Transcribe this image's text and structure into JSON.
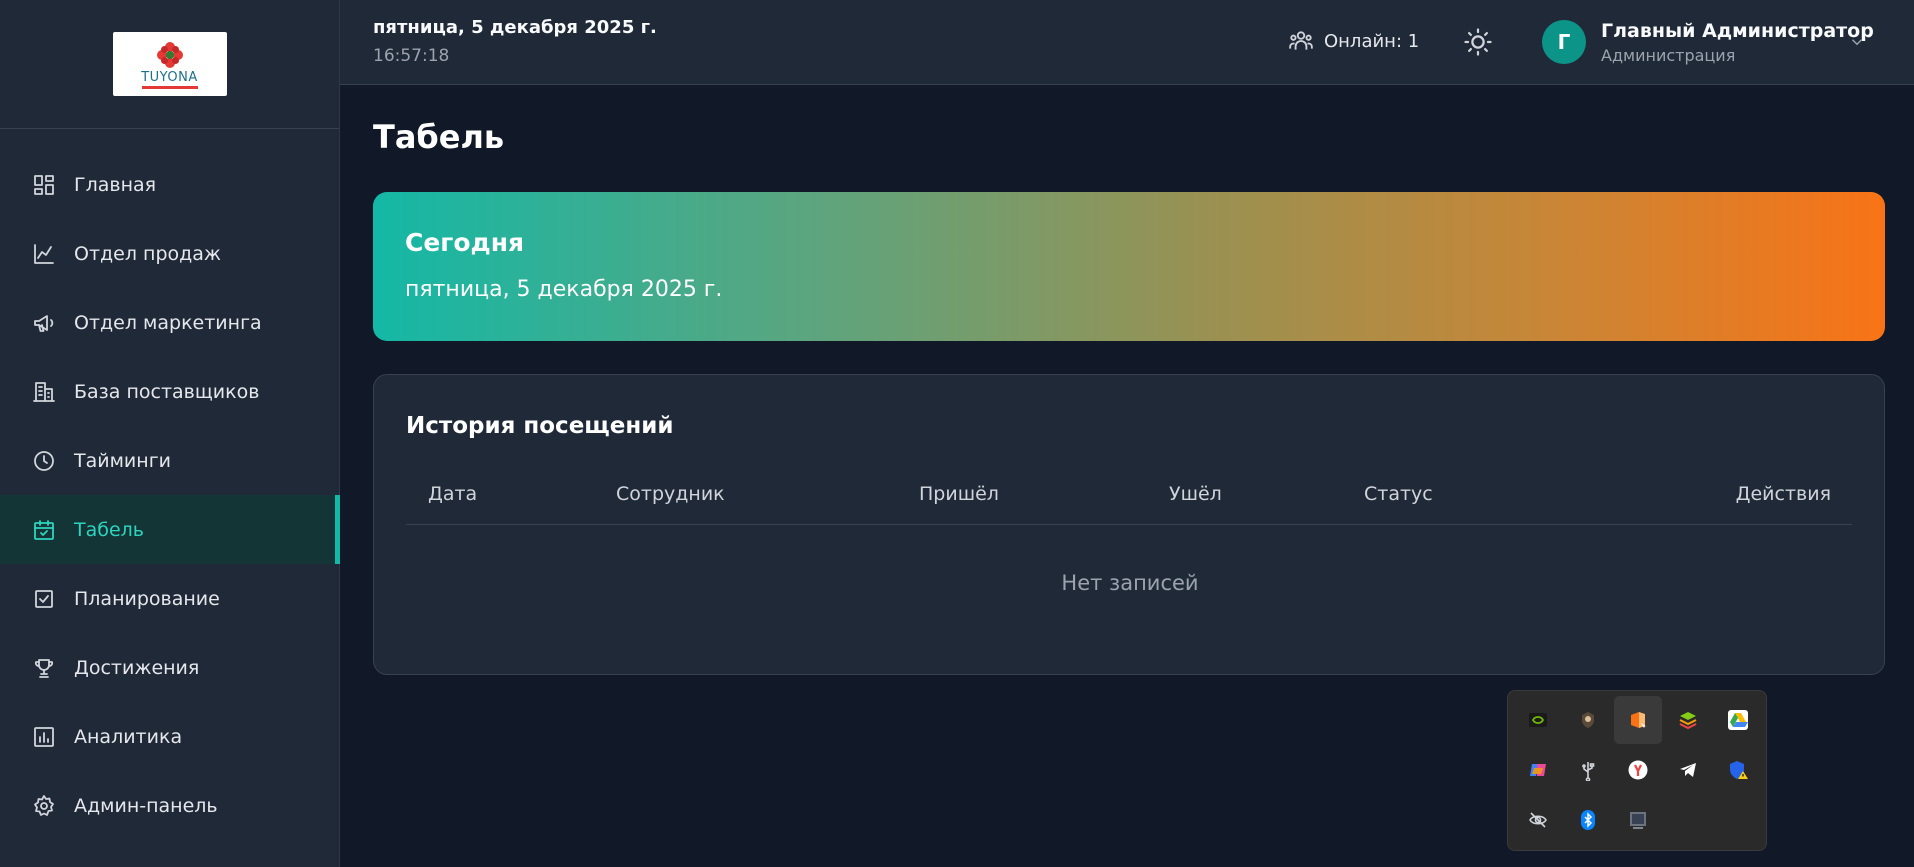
{
  "logo": {
    "brand": "TUYONA"
  },
  "sidebar": {
    "items": [
      {
        "label": "Главная",
        "icon": "dashboard-icon"
      },
      {
        "label": "Отдел продаж",
        "icon": "chart-line-icon"
      },
      {
        "label": "Отдел маркетинга",
        "icon": "megaphone-icon"
      },
      {
        "label": "База поставщиков",
        "icon": "building-icon"
      },
      {
        "label": "Тайминги",
        "icon": "clock-icon"
      },
      {
        "label": "Табель",
        "icon": "calendar-check-icon",
        "active": true
      },
      {
        "label": "Планирование",
        "icon": "checkbox-icon"
      },
      {
        "label": "Достижения",
        "icon": "trophy-icon"
      },
      {
        "label": "Аналитика",
        "icon": "bar-chart-icon"
      },
      {
        "label": "Админ-панель",
        "icon": "gear-icon"
      }
    ]
  },
  "header": {
    "date": "пятница, 5 декабря 2025 г.",
    "time": "16:57:18",
    "online": "Онлайн: 1",
    "user": {
      "initial": "Г",
      "name": "Главный Администратор",
      "role": "Администрация"
    }
  },
  "main": {
    "title": "Табель",
    "today": {
      "title": "Сегодня",
      "date": "пятница, 5 декабря 2025 г."
    },
    "history": {
      "title": "История посещений",
      "columns": [
        "Дата",
        "Сотрудник",
        "Пришёл",
        "Ушёл",
        "Статус",
        "Действия"
      ],
      "empty": "Нет записей"
    }
  },
  "colors": {
    "accent": "#14b8a6",
    "gradient_start": "#14b8a6",
    "gradient_end": "#f97316",
    "background": "#111827",
    "panel": "#1f2937"
  },
  "tray": {
    "icons": [
      "nvidia-icon",
      "shield-app-icon",
      "office-icon",
      "bluestacks-icon",
      "google-drive-icon",
      "copilot-icon",
      "usb-icon",
      "yandex-icon",
      "telegram-icon",
      "defender-warning-icon",
      "hidden-eye-icon",
      "bluetooth-icon",
      "display-icon"
    ]
  }
}
